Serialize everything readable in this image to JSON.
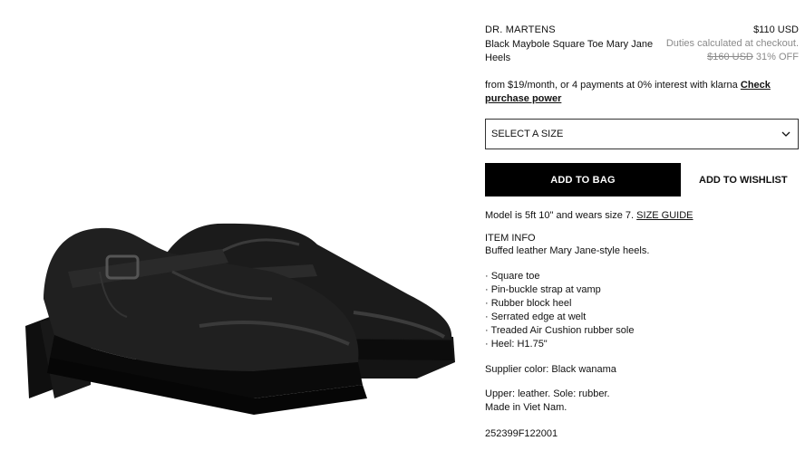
{
  "product": {
    "brand": "DR. MARTENS",
    "title": "Black Maybole Square Toe Mary Jane Heels",
    "price": "$110 USD",
    "duties": "Duties calculated at checkout.",
    "old_price": "$160 USD",
    "discount": "31% OFF"
  },
  "financing": {
    "text": "from $19/month, or 4 payments at 0% interest with klarna",
    "link": "Check purchase power"
  },
  "size_select": {
    "label": "SELECT A SIZE"
  },
  "actions": {
    "add_to_bag": "ADD TO BAG",
    "add_to_wishlist": "ADD TO WISHLIST"
  },
  "model_info": {
    "text": "Model is 5ft 10\" and wears size 7.",
    "size_guide": "SIZE GUIDE"
  },
  "item_info": {
    "heading": "ITEM INFO",
    "description": "Buffed leather Mary Jane-style heels.",
    "features": [
      "· Square toe",
      "· Pin-buckle strap at vamp",
      "· Rubber block heel",
      "· Serrated edge at welt",
      "· Treaded Air Cushion rubber sole",
      "· Heel: H1.75\""
    ],
    "supplier_color": "Supplier color: Black wanama",
    "material": "Upper: leather. Sole: rubber.",
    "origin": "Made in Viet Nam.",
    "sku": "252399F122001"
  },
  "icons": {
    "dropdown": "chevron-down-icon"
  }
}
